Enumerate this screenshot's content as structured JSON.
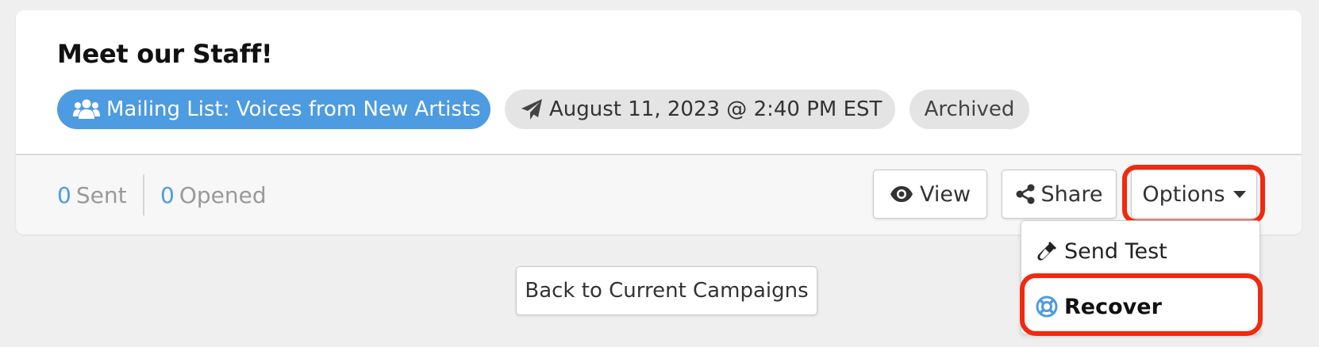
{
  "campaign": {
    "title": "Meet our Staff!",
    "list_label": "Mailing List: Voices from New Artists",
    "send_date": "August 11, 2023 @ 2:40 PM EST",
    "status": "Archived"
  },
  "stats": {
    "sent_count": "0",
    "sent_label": "Sent",
    "opened_count": "0",
    "opened_label": "Opened"
  },
  "actions": {
    "view_label": "View",
    "share_label": "Share",
    "options_label": "Options"
  },
  "options_menu": {
    "items": [
      {
        "label": "Send Test",
        "icon": "test-tube-icon"
      },
      {
        "label": "Recover",
        "icon": "life-ring-icon"
      }
    ]
  },
  "footer": {
    "back_label": "Back to Current Campaigns"
  },
  "colors": {
    "accent": "#4d9be0",
    "highlight": "#ef2a10",
    "pill_gray": "#e4e4e4"
  }
}
